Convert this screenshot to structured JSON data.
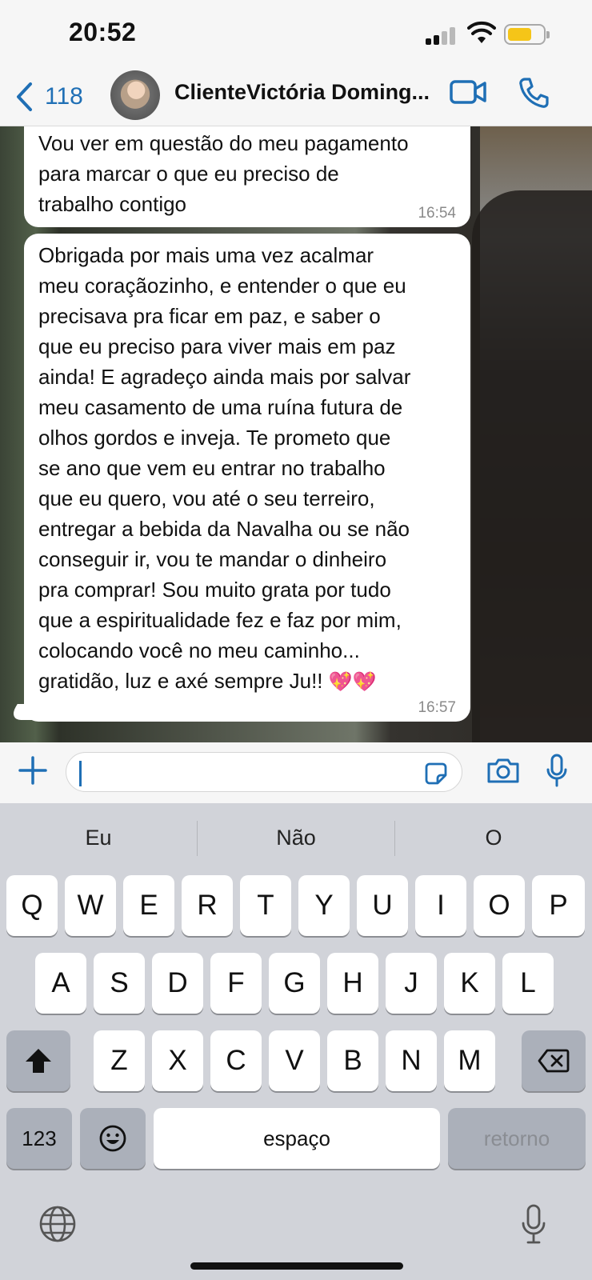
{
  "status_bar": {
    "time": "20:52",
    "battery_level": 0.68,
    "battery_color": "#f5c518"
  },
  "header": {
    "back_count": "118",
    "contact_name": "ClienteVictória Doming...",
    "accent_color": "#1f6fb5",
    "icons": [
      "chevron-left-icon",
      "video-call-icon",
      "phone-icon"
    ]
  },
  "messages": [
    {
      "text": "Vou ver em questão do meu pagamento\npara marcar o que eu preciso de\ntrabalho contigo",
      "time": "16:54"
    },
    {
      "text": "Obrigada por mais uma vez acalmar\nmeu coraçãozinho, e entender o que eu\nprecisava pra ficar em paz, e saber o\nque eu preciso para viver mais em paz\nainda! E agradeço ainda mais por salvar\nmeu casamento de uma ruína futura de\nolhos gordos e inveja. Te prometo que\nse ano que vem eu entrar no trabalho\nque eu quero, vou até o seu terreiro,\nentregar a bebida da Navalha ou se não\nconseguir ir, vou te mandar o dinheiro\npra comprar! Sou muito grata por tudo\nque a espiritualidade fez e faz por mim,\ncolocando você no meu caminho...\ngratidão, luz e axé sempre Ju!! ",
      "emoji": "💖💖",
      "time": "16:57"
    }
  ],
  "input_bar": {
    "value": "",
    "icons": [
      "plus-icon",
      "sticker-icon",
      "camera-icon",
      "microphone-icon"
    ]
  },
  "keyboard": {
    "suggestions": [
      "Eu",
      "Não",
      "O"
    ],
    "row1": [
      "Q",
      "W",
      "E",
      "R",
      "T",
      "Y",
      "U",
      "I",
      "O",
      "P"
    ],
    "row2": [
      "A",
      "S",
      "D",
      "F",
      "G",
      "H",
      "J",
      "K",
      "L"
    ],
    "row3": [
      "Z",
      "X",
      "C",
      "V",
      "B",
      "N",
      "M"
    ],
    "numbers_label": "123",
    "space_label": "espaço",
    "return_label": "retorno",
    "icons": [
      "shift-icon",
      "backspace-icon",
      "emoji-icon",
      "globe-icon",
      "dictation-mic-icon"
    ]
  }
}
